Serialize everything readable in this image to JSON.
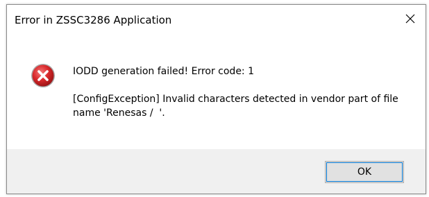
{
  "window": {
    "title": "Error in ZSSC3286 Application",
    "close_icon": "close-icon"
  },
  "message": {
    "icon": "error-icon",
    "icon_color": "#d9292b",
    "line1": "IODD generation failed! Error code: 1",
    "line2": "[ConfigException] Invalid characters detected in vendor part of file name 'Renesas /  '."
  },
  "footer": {
    "ok_label": "OK"
  }
}
